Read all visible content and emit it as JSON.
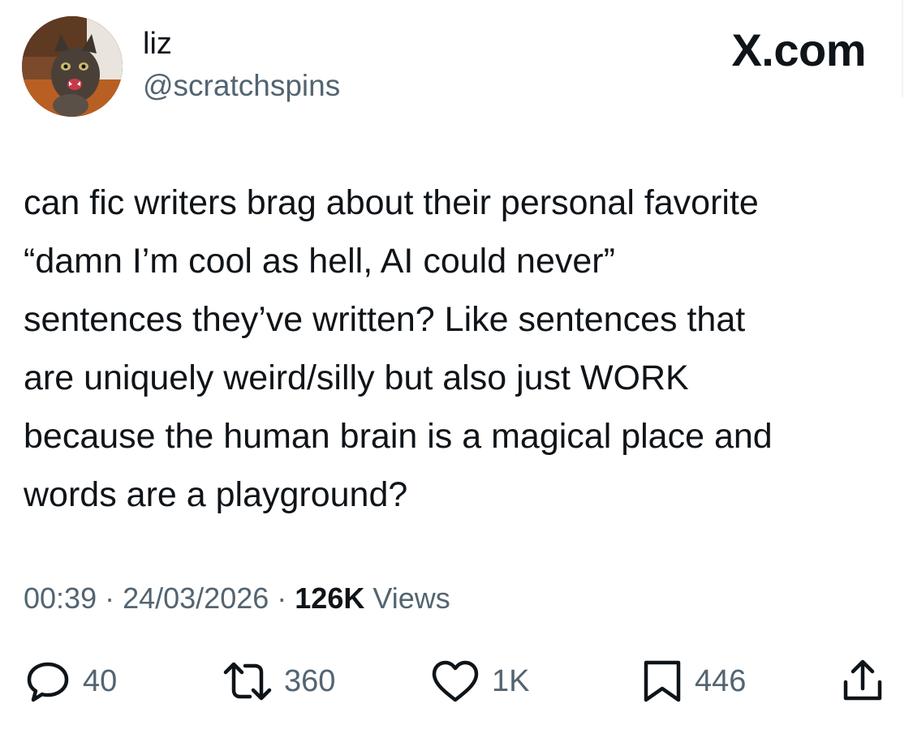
{
  "author": {
    "display_name": "liz",
    "handle": "@scratchspins",
    "avatar_icon": "cat-photo-avatar"
  },
  "brand": {
    "label": "X.com"
  },
  "tweet": {
    "text": "can fic writers brag about their personal favorite\n“damn I’m cool as hell, AI could never”\nsentences they’ve written? Like sentences that\nare uniquely weird/silly but also just WORK\nbecause the human brain is a magical place and\nwords are a playground?"
  },
  "meta": {
    "time": "00:39",
    "separator": "·",
    "date": "24/03/2026",
    "views_count": "126K",
    "views_label": "Views"
  },
  "actions": {
    "reply": {
      "icon": "reply-bubble-icon",
      "count": "40"
    },
    "repost": {
      "icon": "repost-arrows-icon",
      "count": "360"
    },
    "like": {
      "icon": "heart-icon",
      "count": "1K"
    },
    "bookmark": {
      "icon": "bookmark-icon",
      "count": "446"
    },
    "share": {
      "icon": "share-upload-icon"
    }
  },
  "colors": {
    "text_primary": "#0f1419",
    "text_secondary": "#536471",
    "background": "#ffffff"
  }
}
